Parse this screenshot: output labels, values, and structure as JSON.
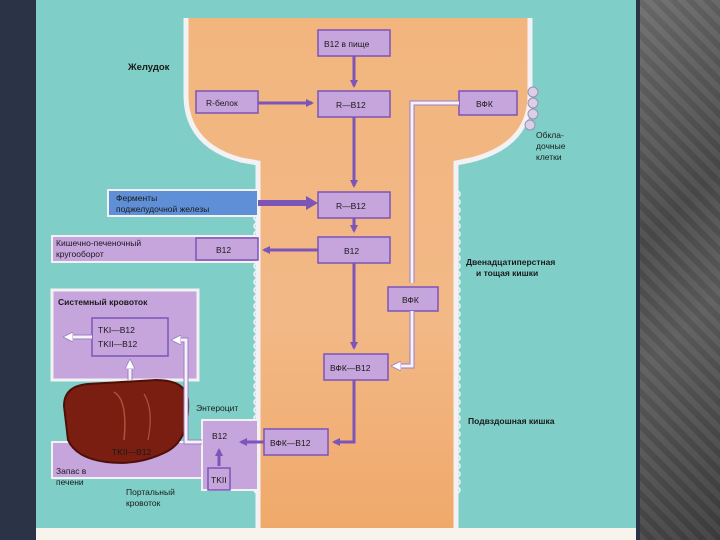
{
  "diagram": {
    "labels": {
      "stomach": "Желудок",
      "b12_food": "B12 в пище",
      "r_protein": "R-белок",
      "r_b12_top": "R—B12",
      "vfk_top": "ВФК",
      "parietal_cells": [
        "Обкла-",
        "дочные",
        "клетки"
      ],
      "pancreas_enzymes": [
        "Ферменты",
        "поджелудочной железы"
      ],
      "r_b12_mid": "R—B12",
      "enterohepatic": [
        "Кишечно-печеночный",
        "кругооборот"
      ],
      "b12_left": "B12",
      "b12_mid": "B12",
      "duodenum": [
        "Двенадцатиперстная",
        "и тощая кишки"
      ],
      "vfk_mid": "ВФК",
      "systemic_circulation": "Системный кровоток",
      "tk_complex": [
        "TKI—B12",
        "TKII—B12"
      ],
      "vfk_b12_low": "ВФК—B12",
      "enterocyte": "Энтероцит",
      "ileum": "Подвздошная кишка",
      "b12_entero": "B12",
      "vfk_b12_entero": "ВФК—B12",
      "tkii_b12": "TKII—B12",
      "tkii": "TKII",
      "liver_storage": [
        "Запас в",
        "печени"
      ],
      "portal_circulation": [
        "Портальный",
        "кровоток"
      ]
    },
    "colors": {
      "teal": "#7fcfc8",
      "gut": "#f1b47a",
      "lavender": "#c6a4dc",
      "arrow_purple": "#7b55b8",
      "blue_box": "#5f8fd6",
      "liver": "#7a1e12"
    }
  }
}
